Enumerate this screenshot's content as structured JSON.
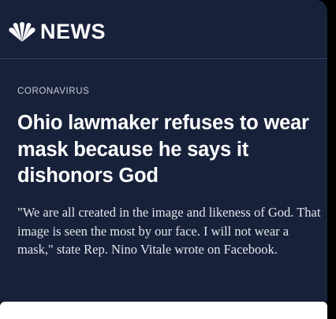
{
  "brand": {
    "name": "NEWS",
    "logo": "nbc-peacock-icon"
  },
  "article": {
    "kicker": "CORONAVIRUS",
    "headline": "Ohio lawmaker refuses to wear mask because he says it dishonors God",
    "blurb": "\"We are all created in the image and likeness of God. That image is seen the most by our face. I will not wear a mask,\" state Rep. Nino Vitale wrote on Facebook."
  },
  "colors": {
    "card_background": "#18213a",
    "page_background": "#000000",
    "text": "#ffffff"
  }
}
